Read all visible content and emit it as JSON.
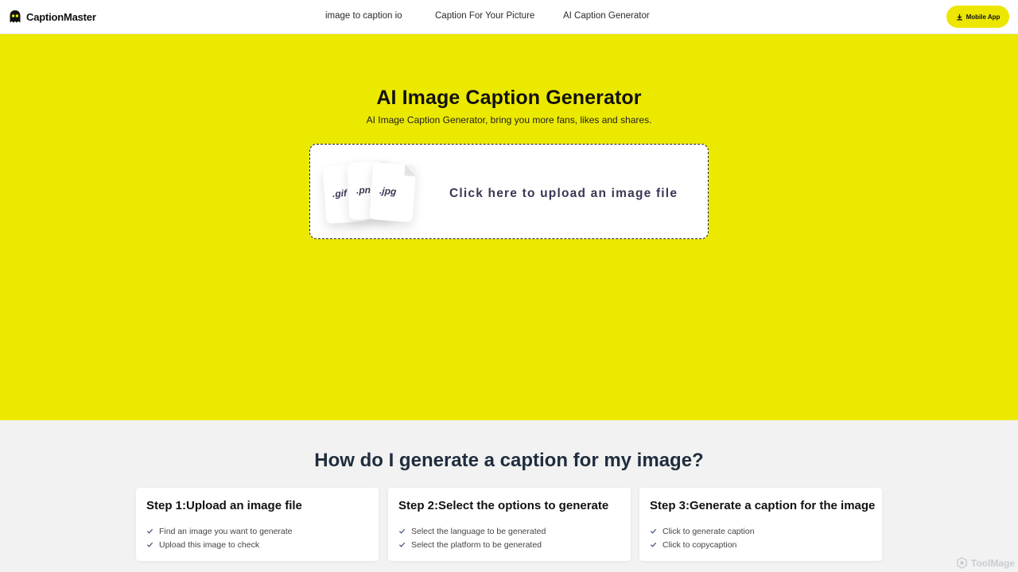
{
  "header": {
    "brand": "CaptionMaster",
    "nav": [
      "image to caption io",
      "Caption For Your Picture",
      "AI Caption Generator"
    ],
    "mobile_button": "Mobile App"
  },
  "hero": {
    "title": "AI Image Caption Generator",
    "subtitle": "AI Image Caption Generator, bring you more fans, likes and shares.",
    "upload_label": "Click here to upload an image file",
    "file_types": [
      ".gif",
      ".pn",
      ".jpg"
    ]
  },
  "how": {
    "title": "How do I generate a caption for my image?",
    "steps": [
      {
        "title": "Step 1:Upload an image file",
        "items": [
          "Find an image you want to generate",
          "Upload this image to check"
        ]
      },
      {
        "title": "Step 2:Select the options to generate",
        "items": [
          "Select the language to be generated",
          "Select the platform to be generated"
        ]
      },
      {
        "title": "Step 3:Generate a caption for the image",
        "items": [
          "Click to generate caption",
          "Click to copycaption"
        ]
      }
    ]
  },
  "watermark": "ToolMage",
  "colors": {
    "accent": "#ece900",
    "button": "#ece600",
    "upload_text": "#3b3654"
  }
}
